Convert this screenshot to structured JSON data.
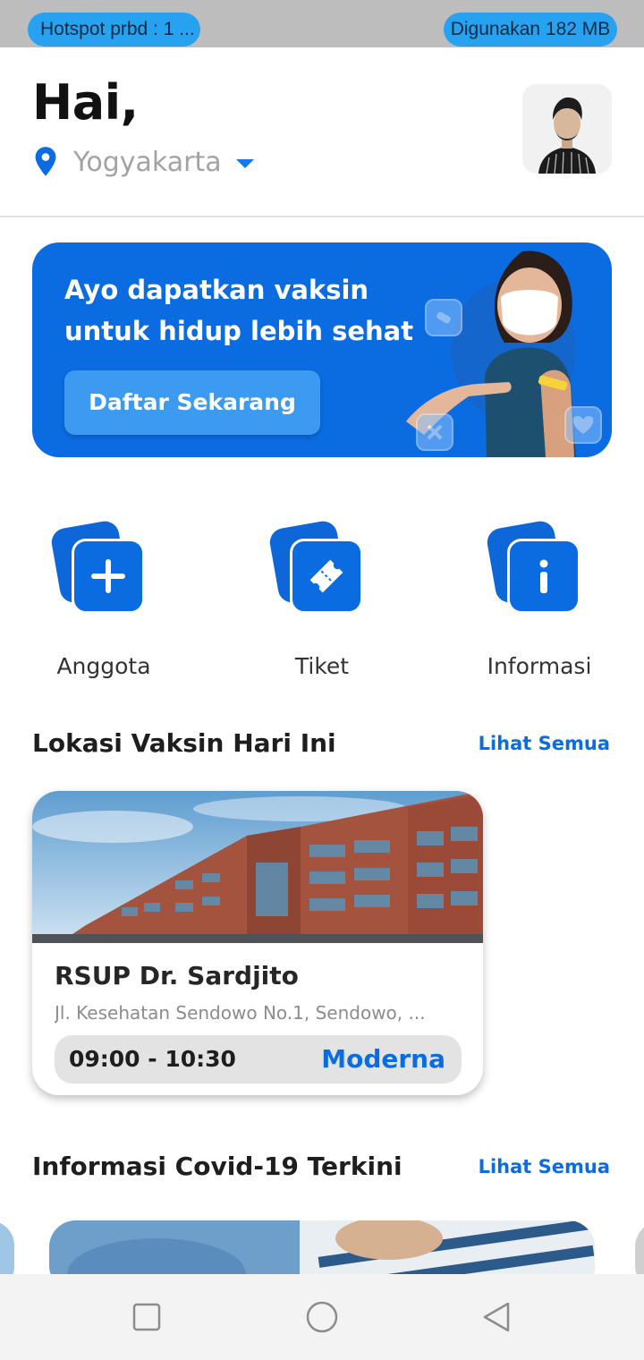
{
  "status_bar": {
    "hotspot": "Hotspot prbd : 1 ...",
    "data_usage": "Digunakan 182 MB"
  },
  "header": {
    "greeting": "Hai,",
    "location": "Yogyakarta",
    "location_icon": "location-pin-icon",
    "dropdown_icon": "caret-down-icon"
  },
  "banner": {
    "title": "Ayo dapatkan vaksin untuk hidup lebih sehat",
    "button_label": "Daftar Sekarang"
  },
  "actions": [
    {
      "label": "Anggota",
      "icon": "plus-icon"
    },
    {
      "label": "Tiket",
      "icon": "ticket-icon"
    },
    {
      "label": "Informasi",
      "icon": "info-icon"
    }
  ],
  "vaccine_section": {
    "title": "Lokasi Vaksin Hari Ini",
    "see_all": "Lihat Semua",
    "card": {
      "name": "RSUP Dr. Sardjito",
      "address": "Jl. Kesehatan Sendowo No.1, Sendowo, ...",
      "time": "09:00 - 10:30",
      "vaccine": "Moderna"
    }
  },
  "covid_section": {
    "title": "Informasi Covid-19 Terkini",
    "see_all": "Lihat Semua"
  },
  "colors": {
    "primary": "#0b6ce2",
    "button_light": "#3c9bf0",
    "status_pill": "#27a2f0"
  },
  "nav": [
    "square-recent-icon",
    "circle-home-icon",
    "triangle-back-icon"
  ]
}
